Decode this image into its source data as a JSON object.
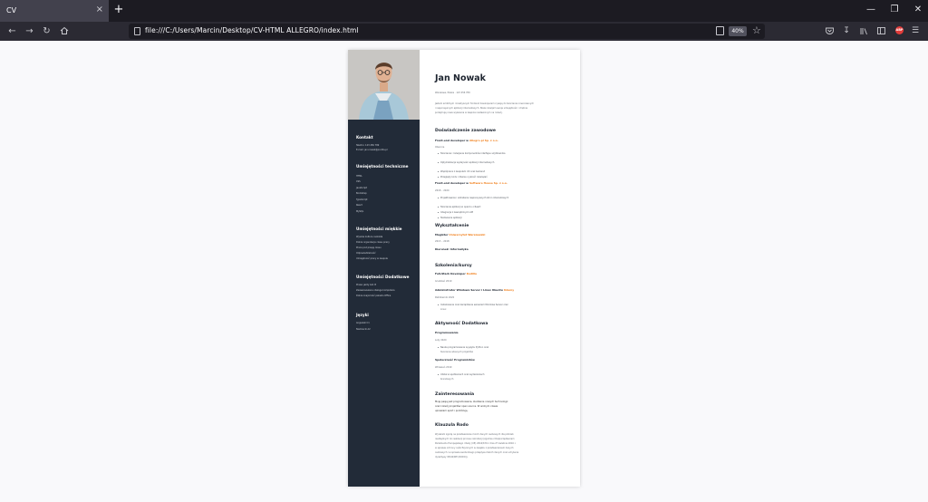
{
  "browser": {
    "tab_title": "CV",
    "tab_close": "×",
    "new_tab": "+",
    "url": "file:///C:/Users/Marcin/Desktop/CV-HTML ALLEGRO/index.html",
    "zoom": "40%",
    "window_min": "—",
    "window_max": "❐",
    "window_close": "✕",
    "extension_abp": "ABP"
  },
  "cv": {
    "name": "Jan Nowak",
    "sidebar": {
      "contact_title": "Kontakt",
      "tech_title": "Umiejętności techniczne",
      "soft_title": "Umiejętności miękkie",
      "extra_title": "Umiejętności Dodatkowe",
      "lang_title": "Języki",
      "contact_lines": [
        "Telefon: 123 456 789",
        "E-mail: jan.nowak@poczta.pl"
      ],
      "tech_items": [
        "HTML",
        "CSS",
        "JavaScript",
        "Bootstrap",
        "TypeScript",
        "React",
        "MySQL"
      ],
      "soft_items": [
        "Wysoka kultura osobista",
        "Dobra organizacja czasu pracy",
        "Praca pod presją czasu",
        "Odpowiedzialność",
        "Umiejętność pracy w zespole"
      ],
      "extra_items": [
        "Prawo jazdy kat. B",
        "Zaawansowana obsługa komputera",
        "Dobra znajomość pakietu Office"
      ],
      "lang_items": [
        "Angielski C1",
        "Niemiecki A2"
      ]
    },
    "main": {
      "contact_line": "Warszawa, Polska · 123 456 789",
      "intro": [
        "Jestem ambitnym i kreatywnym frontend developerem z pasją do tworzenia nowoczesnych",
        "i responsywnych aplikacji internetowych. Stale rozwijam swoje umiejętności i chętnie",
        "podejmuję nowe wyzwania w zespole nastawionym na rozwój."
      ],
      "experience_title": "Doświadczenie zawodowe",
      "job1_title": "Front-end developer w",
      "job1_company": "Allegro.pl Sp. z o.o.",
      "job1_date": "Obecnie",
      "job1_bullets": [
        "Tworzenie i rozwijanie komponentów interfejsu użytkownika",
        "Optymalizacja wydajności aplikacji internetowych",
        "Współpraca z zespołem UX oraz backend",
        "Przeglądy kodu i dbanie o jakość rozwiązań"
      ],
      "job2_title": "Front-end developer w",
      "job2_company": "Software House Sp. z o.o.",
      "job2_date": "2018 – 2020",
      "job2_bullets": [
        "Projektowanie i wdrażanie responsywnych stron internetowych",
        "Tworzenie aplikacji w oparciu o React",
        "Integracja z zewnętrznymi API",
        "Testowanie aplikacji"
      ],
      "education_title": "Wykształcenie",
      "edu_degree": "Magister",
      "edu_school": "Uniwersytet Warszawski",
      "edu_date": "2013 – 2018",
      "edu_field": "Kierunek: Informatyka",
      "courses_title": "Szkolenia/kursy",
      "course1": "Full-Stack Developer",
      "course1_org": "Kodilla",
      "course1_date": "Grudzień 2019",
      "course2": "Administrator Windows Server i Linux Ubuntu",
      "course2_org": "Udemy",
      "course2_date": "Październik 2020",
      "course2_bullet": [
        "Instalowanie oraz zarządzanie serwerem Windows Server oraz",
        "Linux"
      ],
      "activity_title": "Aktywność Dodatkowa",
      "act1_title": "Programowanie",
      "act1_date": "Luty 2020",
      "act1_bullet": [
        "Nauka programowania w języku Python oraz",
        "tworzenie własnych projektów"
      ],
      "act2_title": "Społeczność Programistów",
      "act2_date": "Wrzesień 2019",
      "act2_bullet": [
        "Udział w spotkaniach oraz wydarzeniach",
        "branżowych"
      ],
      "interests_title": "Zainteresowania",
      "interests_text": [
        "Moją pasją jest programowanie, śledzenie nowych technologii",
        "oraz rozwój projektów open source. W wolnym czasie",
        "uprawiam sport i podróżuję."
      ],
      "rodo_title": "Klauzula Rodo",
      "rodo_text": [
        "Wyrażam zgodę na przetwarzanie moich danych osobowych dla potrzeb",
        "niezbędnych do realizacji procesu rekrutacji (zgodnie z Rozporządzeniem",
        "Parlamentu Europejskiego i Rady (UE) 2016/679 z dnia 27 kwietnia 2016 r.",
        "w sprawie ochrony osób fizycznych w związku z przetwarzaniem danych",
        "osobowych i w sprawie swobodnego przepływu takich danych oraz uchylenia",
        "dyrektywy 95/46/WE (RODO))."
      ]
    }
  }
}
